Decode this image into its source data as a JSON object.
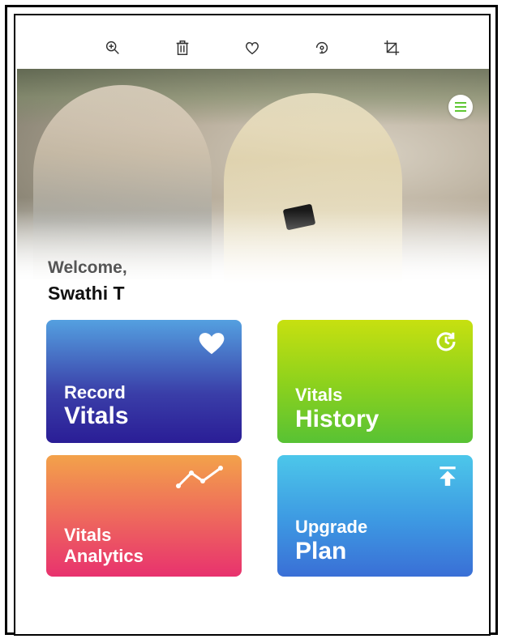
{
  "toolbar": {
    "icons": [
      "zoom-in-icon",
      "trash-icon",
      "heart-icon",
      "rotate-icon",
      "crop-icon"
    ]
  },
  "greeting": {
    "welcome": "Welcome,",
    "username": "Swathi T"
  },
  "tiles": [
    {
      "line1": "Record",
      "line2": "Vitals",
      "icon": "heart-icon",
      "color": "#3a3ea8"
    },
    {
      "line1": "Vitals",
      "line2": "History",
      "icon": "history-clock-icon",
      "color": "#8fd21c"
    },
    {
      "line1": "Vitals",
      "line2": "Analytics",
      "icon": "trend-line-icon",
      "color": "#ee6a5c"
    },
    {
      "line1": "Upgrade",
      "line2": "Plan",
      "icon": "upload-arrow-icon",
      "color": "#3d98e2"
    }
  ],
  "colors": {
    "menu_accent": "#5fc733"
  }
}
